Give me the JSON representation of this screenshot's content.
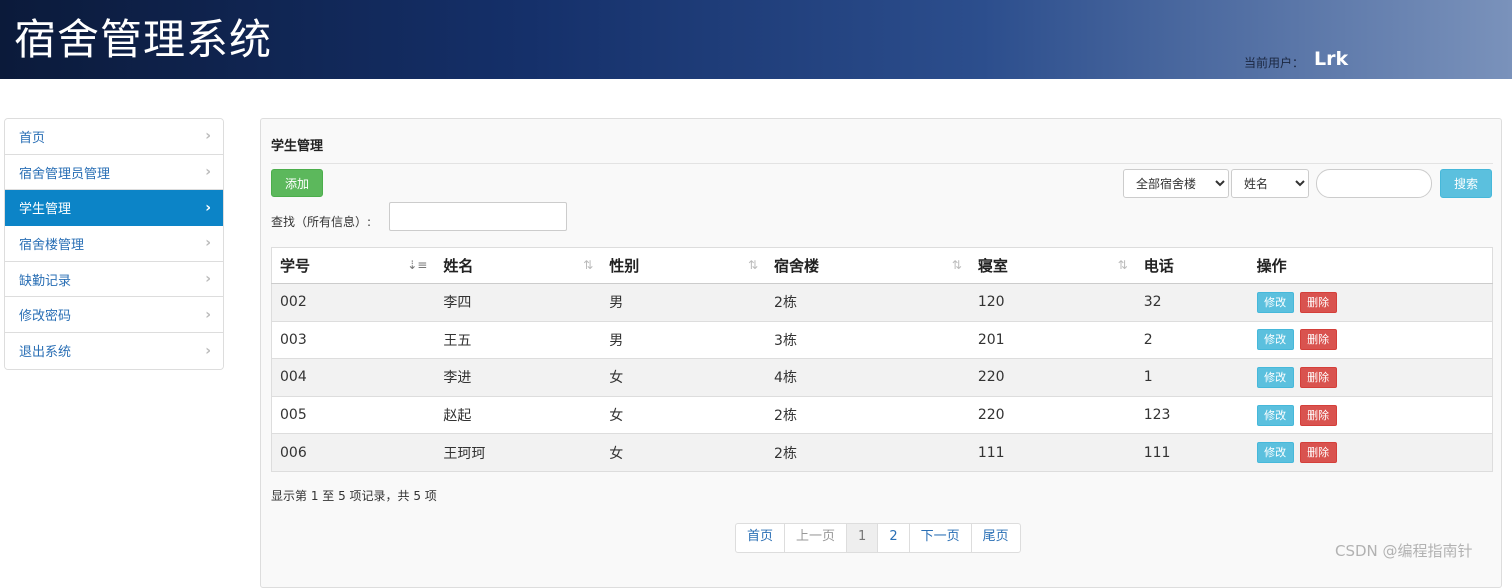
{
  "header": {
    "title": "宿舍管理系统",
    "user_label": "当前用户：",
    "user_name": "Lrk"
  },
  "sidebar": {
    "items": [
      {
        "label": "首页",
        "active": false
      },
      {
        "label": "宿舍管理员管理",
        "active": false
      },
      {
        "label": "学生管理",
        "active": true
      },
      {
        "label": "宿舍楼管理",
        "active": false
      },
      {
        "label": "缺勤记录",
        "active": false
      },
      {
        "label": "修改密码",
        "active": false
      },
      {
        "label": "退出系统",
        "active": false
      }
    ]
  },
  "panel": {
    "title": "学生管理",
    "add_label": "添加",
    "building_select": "全部宿舍楼",
    "field_select": "姓名",
    "search_label": "搜索",
    "find_label": "查找（所有信息）:"
  },
  "table": {
    "headers": [
      "学号",
      "姓名",
      "性别",
      "宿舍楼",
      "寝室",
      "电话",
      "操作"
    ],
    "rows": [
      [
        "002",
        "李四",
        "男",
        "2栋",
        "120",
        "32"
      ],
      [
        "003",
        "王五",
        "男",
        "3栋",
        "201",
        "2"
      ],
      [
        "004",
        "李进",
        "女",
        "4栋",
        "220",
        "1"
      ],
      [
        "005",
        "赵起",
        "女",
        "2栋",
        "220",
        "123"
      ],
      [
        "006",
        "王珂珂",
        "女",
        "2栋",
        "111",
        "111"
      ]
    ],
    "edit_label": "修改",
    "delete_label": "删除"
  },
  "footer": {
    "records": "显示第 1 至 5 项记录，共 5 项"
  },
  "pagination": [
    "首页",
    "上一页",
    "1",
    "2",
    "下一页",
    "尾页"
  ],
  "watermark": "CSDN @编程指南针",
  "colors": {
    "accent": "#0c84c7",
    "success": "#5cb85c",
    "info": "#5bc0de",
    "danger": "#d9534f"
  }
}
